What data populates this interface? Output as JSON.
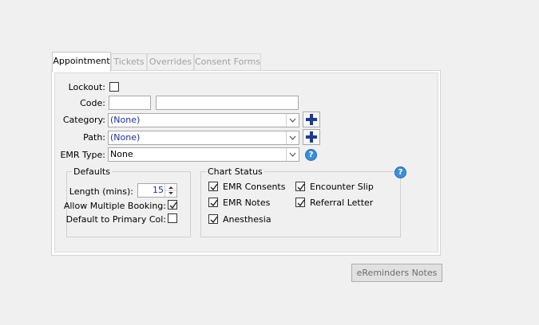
{
  "tabs": [
    "Appointment",
    "Tickets",
    "Overrides",
    "Consent Forms"
  ],
  "form": {
    "lockout_label": "Lockout:",
    "lockout_checked": false,
    "code_label": "Code:",
    "code_value": "",
    "code_desc_value": "",
    "category_label": "Category:",
    "category_value": "(None)",
    "path_label": "Path:",
    "path_value": "(None)",
    "emr_type_label": "EMR Type:",
    "emr_type_value": "None"
  },
  "defaults": {
    "title": "Defaults",
    "length_label": "Length (mins):",
    "length_value": "15",
    "allow_multiple_label": "Allow Multiple Booking:",
    "allow_multiple_checked": true,
    "default_primary_label": "Default to Primary Col:",
    "default_primary_checked": false
  },
  "chart_status": {
    "title": "Chart Status",
    "items": [
      {
        "label": "EMR Consents",
        "checked": true
      },
      {
        "label": "Encounter Slip",
        "checked": true
      },
      {
        "label": "EMR Notes",
        "checked": true
      },
      {
        "label": "Referral Letter",
        "checked": true
      },
      {
        "label": "Anesthesia",
        "checked": true
      }
    ]
  },
  "ereminders_button": "eReminders Notes",
  "icons": {
    "plus": "plus-icon",
    "help": "help-icon",
    "dropdown": "chevron-down-icon",
    "check": "check-icon",
    "spinner": "spinner-arrows-icon"
  },
  "colors": {
    "combo_text": "#1a2fa0",
    "plus_blue": "#1f3a8c",
    "help_blue": "#3b8fd6",
    "length_text": "#1a2fa0"
  }
}
